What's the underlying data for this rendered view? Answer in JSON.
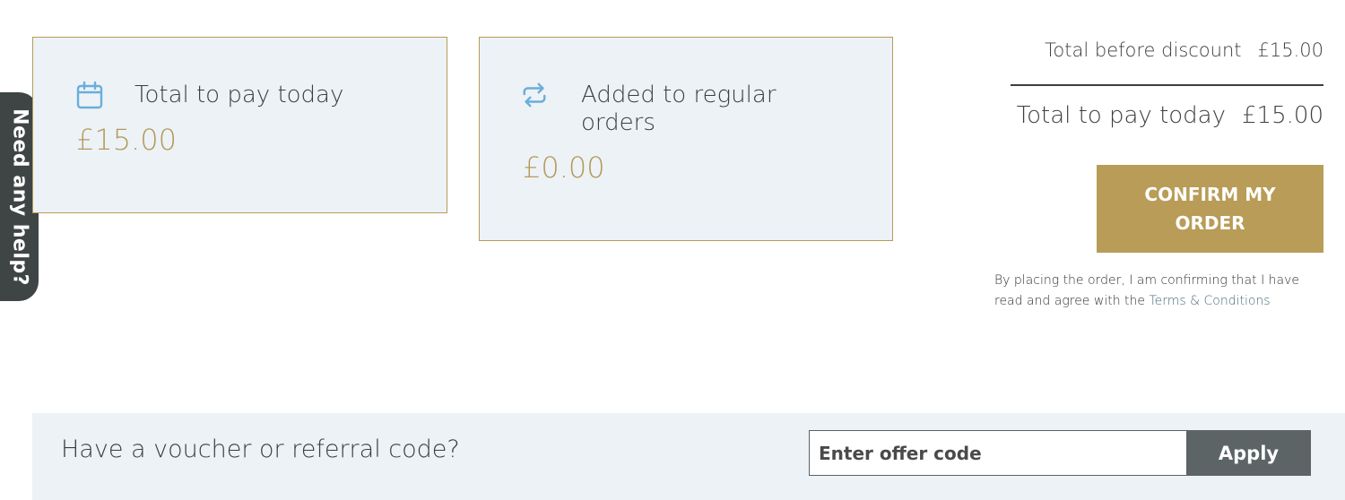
{
  "help_tab": {
    "label": "Need any help?"
  },
  "cards": {
    "today": {
      "icon": "calendar-icon",
      "title": "Total to pay today",
      "amount": "£15.00"
    },
    "regular": {
      "icon": "repeat-icon",
      "title": "Added to regular orders",
      "amount": "£0.00"
    }
  },
  "summary": {
    "before_label": "Total before discount",
    "before_amount": "£15.00",
    "total_label": "Total to pay today",
    "total_amount": "£15.00",
    "confirm_label": "CONFIRM MY ORDER",
    "legal_text": "By placing the order, I am confirming that I have read and agree with the ",
    "legal_link": "Terms & Conditions"
  },
  "voucher": {
    "label": "Have a voucher or referral code?",
    "placeholder": "Enter offer code",
    "value": "",
    "apply_label": "Apply"
  },
  "colors": {
    "accent": "#b89c57",
    "card_bg": "#edf2f6",
    "icon_blue": "#6aaedb",
    "dark_button": "#5c6466",
    "help_tab": "#3f4545"
  }
}
